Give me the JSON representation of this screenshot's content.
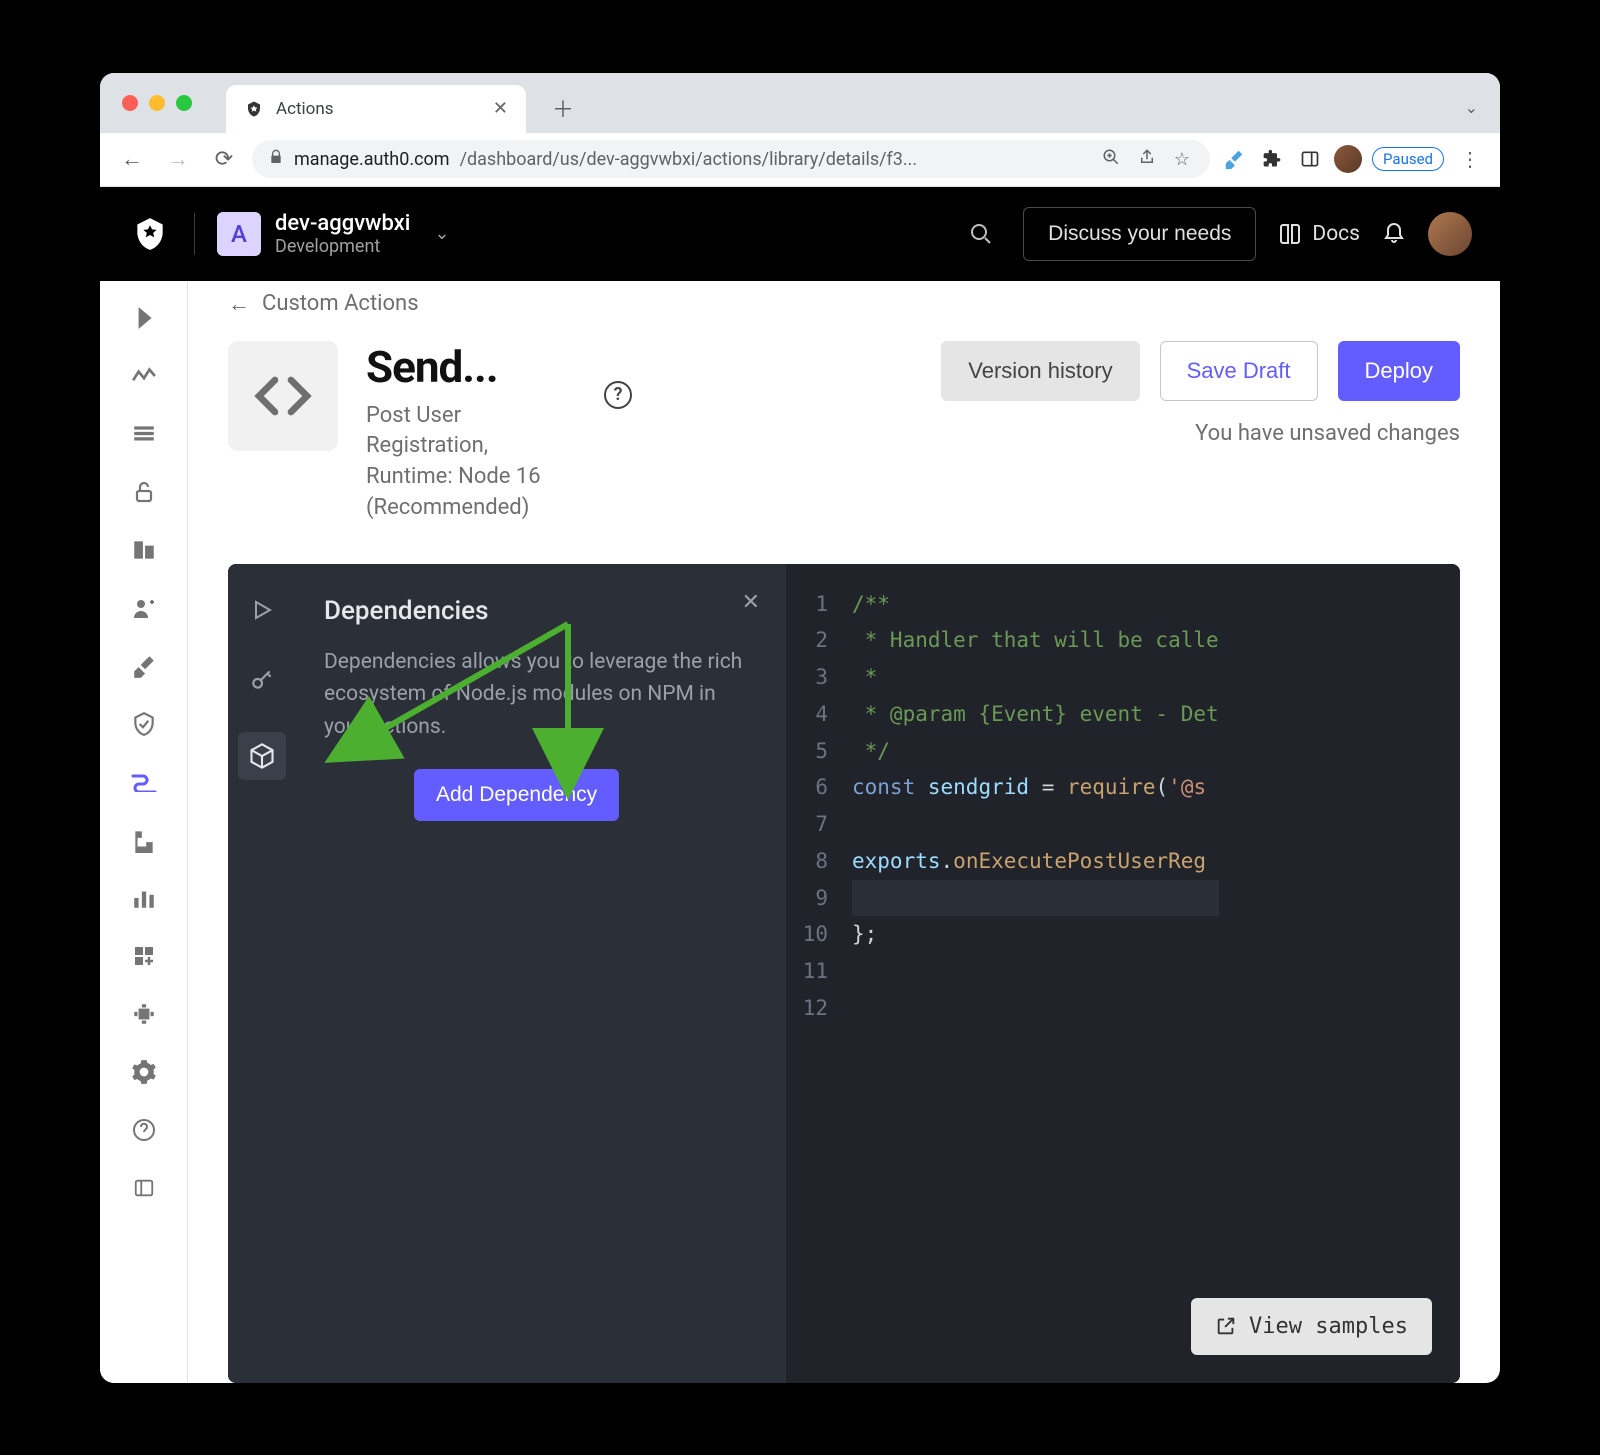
{
  "browser": {
    "tab_title": "Actions",
    "url_host": "manage.auth0.com",
    "url_path": "/dashboard/us/dev-aggvwbxi/actions/library/details/f3...",
    "paused_label": "Paused"
  },
  "header": {
    "tenant_name": "dev-aggvwbxi",
    "tenant_env": "Development",
    "discuss_label": "Discuss your needs",
    "docs_label": "Docs"
  },
  "breadcrumb": {
    "label": "Custom Actions"
  },
  "page": {
    "title": "Send...",
    "subtitle": "Post User Registration, Runtime: Node 16 (Recommended)",
    "version_history": "Version history",
    "save_draft": "Save Draft",
    "deploy": "Deploy",
    "unsaved": "You have unsaved changes"
  },
  "deps": {
    "title": "Dependencies",
    "description": "Dependencies allows you to leverage the rich ecosystem of Node.js modules on NPM in your Actions.",
    "add_button": "Add Dependency"
  },
  "code": {
    "lines": [
      "/**",
      " * Handler that will be calle",
      " *",
      " * @param {Event} event - Det",
      " */",
      "const sendgrid = require('@s",
      "",
      "exports.onExecutePostUserReg",
      "",
      "};",
      "",
      ""
    ]
  },
  "view_samples": "View samples"
}
